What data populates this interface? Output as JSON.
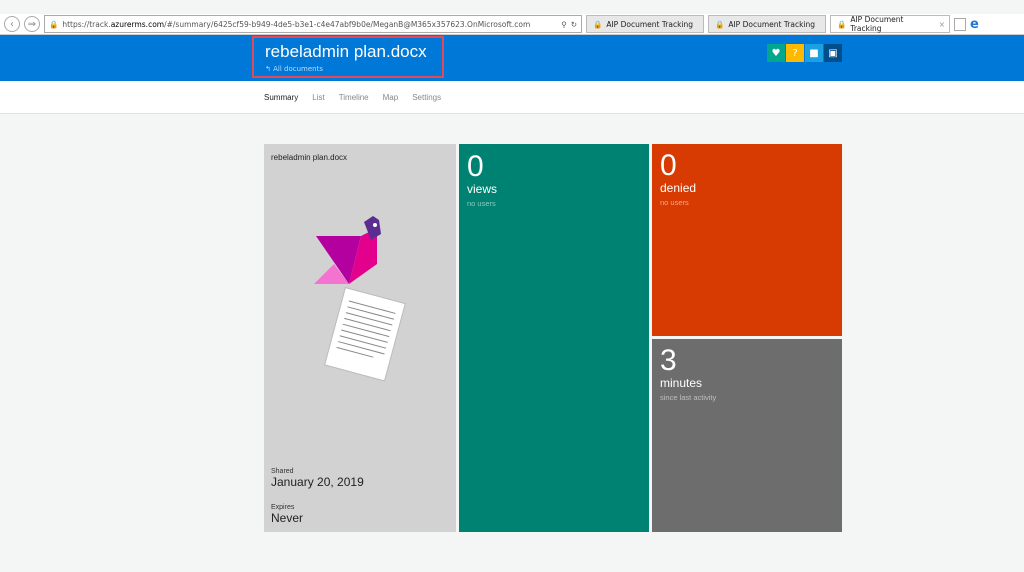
{
  "browser": {
    "url_prefix": "https://track.",
    "url_domain": "azurerms.com",
    "url_rest": "/#/summary/6425cf59-b949-4de5-b3e1-c4e47abf9b0e/MeganB@M365x357623.OnMicrosoft.com",
    "tabs": [
      {
        "title": "AIP Document Tracking"
      },
      {
        "title": "AIP Document Tracking"
      },
      {
        "title": "AIP Document Tracking"
      }
    ]
  },
  "header": {
    "title": "rebeladmin plan.docx",
    "back_link": "All documents",
    "icons": [
      "heart-icon",
      "help-icon",
      "user-icon",
      "feedback-icon"
    ],
    "icon_colors": [
      "#00a78e",
      "#ffb900",
      "#1ba1e2",
      "#004e8c"
    ]
  },
  "nav": [
    "Summary",
    "List",
    "Timeline",
    "Map",
    "Settings"
  ],
  "doc_tile": {
    "name": "rebeladmin plan.docx",
    "shared_label": "Shared",
    "shared_date": "January 20, 2019",
    "expires_label": "Expires",
    "expires_value": "Never"
  },
  "views_tile": {
    "count": "0",
    "unit": "views",
    "sub": "no users",
    "color": "#008272"
  },
  "denied_tile": {
    "count": "0",
    "unit": "denied",
    "sub": "no users",
    "color": "#d83b01"
  },
  "activity_tile": {
    "count": "3",
    "unit": "minutes",
    "sub": "since last activity",
    "color": "#6d6d6d"
  }
}
